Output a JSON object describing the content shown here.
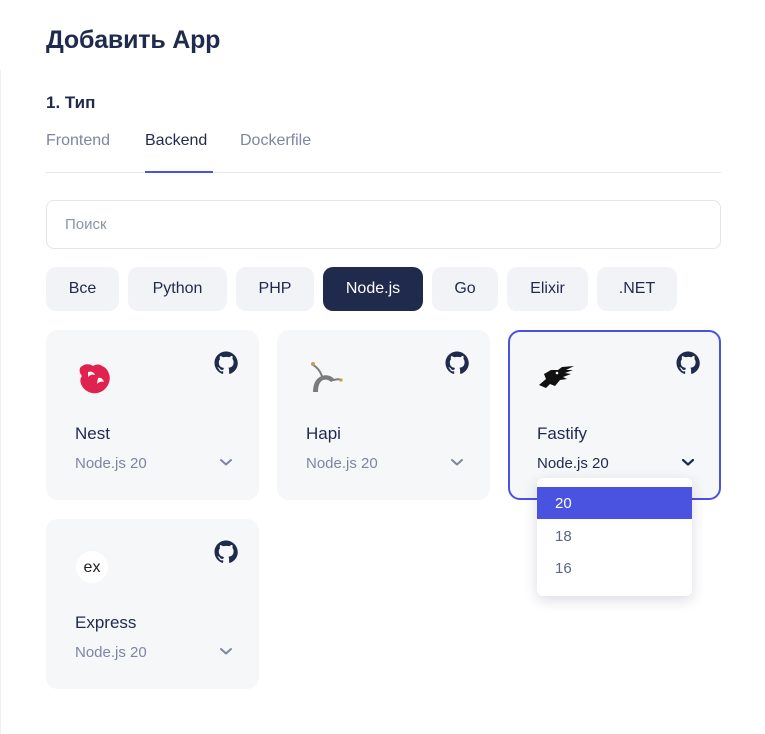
{
  "title": "Добавить App",
  "section": "1. Тип",
  "tabs": [
    {
      "label": "Frontend",
      "active": false
    },
    {
      "label": "Backend",
      "active": true
    },
    {
      "label": "Dockerfile",
      "active": false
    }
  ],
  "search": {
    "placeholder": "Поиск",
    "value": ""
  },
  "filters": [
    {
      "label": "Все",
      "active": false
    },
    {
      "label": "Python",
      "active": false
    },
    {
      "label": "PHP",
      "active": false
    },
    {
      "label": "Node.js",
      "active": true
    },
    {
      "label": "Go",
      "active": false
    },
    {
      "label": "Elixir",
      "active": false
    },
    {
      "label": ".NET",
      "active": false
    }
  ],
  "cards": [
    {
      "name": "Nest",
      "version": "Node.js 20",
      "icon": "nestjs-logo-icon",
      "selected": false
    },
    {
      "name": "Hapi",
      "version": "Node.js 20",
      "icon": "hapi-logo-icon",
      "selected": false
    },
    {
      "name": "Fastify",
      "version": "Node.js 20",
      "icon": "fastify-logo-icon",
      "selected": true
    },
    {
      "name": "Express",
      "version": "Node.js 20",
      "icon": "express-logo-icon",
      "selected": false
    }
  ],
  "version_dropdown": {
    "options": [
      "20",
      "18",
      "16"
    ],
    "selected": "20"
  },
  "colors": {
    "accent": "#4a52e0",
    "dark": "#1f2a4d",
    "muted": "#7c86a2",
    "card_bg": "#f6f7f9",
    "nest_red": "#e0234e"
  }
}
